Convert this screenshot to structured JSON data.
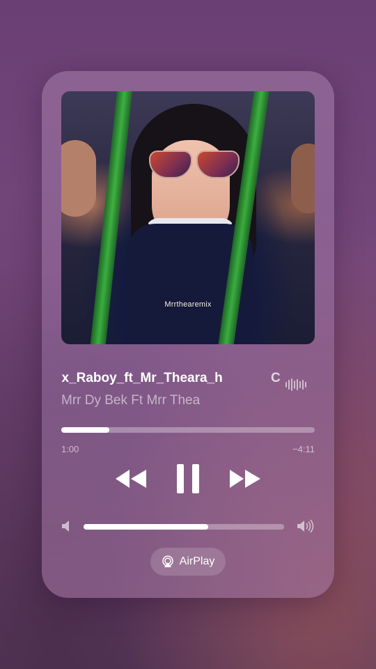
{
  "now_playing": {
    "title": "Remix_Raboy_ft_Mr_Theara_h",
    "title_tail": "C",
    "artist": "Mrr Dy Bek Ft Mrr Thea",
    "artwork_watermark": "Mrrthearemix",
    "elapsed": "1:00",
    "remaining": "−4:11",
    "progress_fraction": 0.19
  },
  "volume": {
    "level_fraction": 0.62
  },
  "airplay": {
    "label": "AirPlay"
  },
  "icons": {
    "rewind": "rewind-icon",
    "pause": "pause-icon",
    "forward": "fast-forward-icon",
    "volume_min": "speaker-low-icon",
    "volume_max": "speaker-high-icon",
    "airplay": "airplay-icon",
    "waveform": "waveform-icon"
  },
  "colors": {
    "accent": "#ffffff",
    "panel": "#9a72a3"
  }
}
